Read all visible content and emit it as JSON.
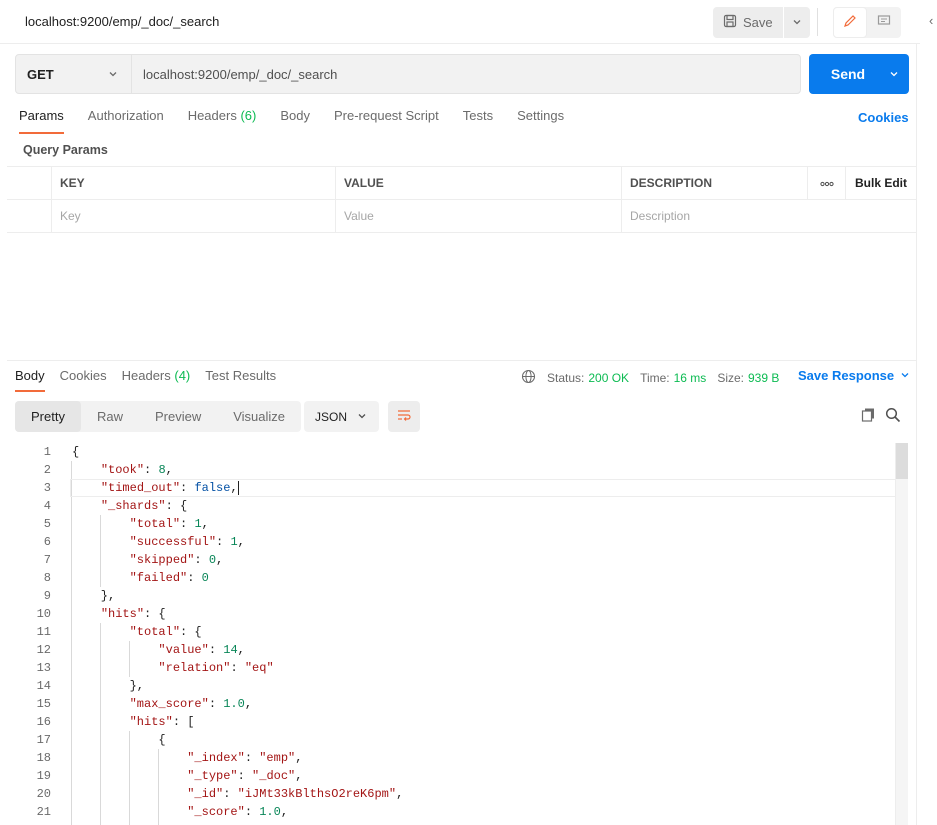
{
  "tab": {
    "title": "localhost:9200/emp/_doc/_search"
  },
  "toolbar": {
    "save_label": "Save"
  },
  "request": {
    "method": "GET",
    "url": "localhost:9200/emp/_doc/_search",
    "send_label": "Send",
    "tabs": [
      {
        "label": "Params",
        "count": ""
      },
      {
        "label": "Authorization",
        "count": ""
      },
      {
        "label": "Headers",
        "count": "(6)"
      },
      {
        "label": "Body",
        "count": ""
      },
      {
        "label": "Pre-request Script",
        "count": ""
      },
      {
        "label": "Tests",
        "count": ""
      },
      {
        "label": "Settings",
        "count": ""
      }
    ],
    "cookies_label": "Cookies"
  },
  "params": {
    "title": "Query Params",
    "headers": {
      "key": "KEY",
      "value": "VALUE",
      "description": "DESCRIPTION",
      "bulk_edit": "Bulk Edit"
    },
    "placeholders": {
      "key": "Key",
      "value": "Value",
      "description": "Description"
    }
  },
  "response": {
    "tabs": [
      {
        "label": "Body",
        "count": ""
      },
      {
        "label": "Cookies",
        "count": ""
      },
      {
        "label": "Headers",
        "count": "(4)"
      },
      {
        "label": "Test Results",
        "count": ""
      }
    ],
    "status_label": "Status:",
    "status_value": "200 OK",
    "time_label": "Time:",
    "time_value": "16 ms",
    "size_label": "Size:",
    "size_value": "939 B",
    "save_response_label": "Save Response",
    "views": [
      "Pretty",
      "Raw",
      "Preview",
      "Visualize"
    ],
    "format": "JSON"
  },
  "code_lines": [
    {
      "n": "1",
      "html": "{"
    },
    {
      "n": "2",
      "html": "    <span class=\"key\">\"took\"</span>: <span class=\"num\">8</span>,"
    },
    {
      "n": "3",
      "html": "    <span class=\"key\">\"timed_out\"</span>: <span class=\"kw\">false</span>,"
    },
    {
      "n": "4",
      "html": "    <span class=\"key\">\"_shards\"</span>: {"
    },
    {
      "n": "5",
      "html": "        <span class=\"key\">\"total\"</span>: <span class=\"num\">1</span>,"
    },
    {
      "n": "6",
      "html": "        <span class=\"key\">\"successful\"</span>: <span class=\"num\">1</span>,"
    },
    {
      "n": "7",
      "html": "        <span class=\"key\">\"skipped\"</span>: <span class=\"num\">0</span>,"
    },
    {
      "n": "8",
      "html": "        <span class=\"key\">\"failed\"</span>: <span class=\"num\">0</span>"
    },
    {
      "n": "9",
      "html": "    },"
    },
    {
      "n": "10",
      "html": "    <span class=\"key\">\"hits\"</span>: {"
    },
    {
      "n": "11",
      "html": "        <span class=\"key\">\"total\"</span>: {"
    },
    {
      "n": "12",
      "html": "            <span class=\"key\">\"value\"</span>: <span class=\"num\">14</span>,"
    },
    {
      "n": "13",
      "html": "            <span class=\"key\">\"relation\"</span>: <span class=\"str\">\"eq\"</span>"
    },
    {
      "n": "14",
      "html": "        },"
    },
    {
      "n": "15",
      "html": "        <span class=\"key\">\"max_score\"</span>: <span class=\"num\">1.0</span>,"
    },
    {
      "n": "16",
      "html": "        <span class=\"key\">\"hits\"</span>: ["
    },
    {
      "n": "17",
      "html": "            {"
    },
    {
      "n": "18",
      "html": "                <span class=\"key\">\"_index\"</span>: <span class=\"str\">\"emp\"</span>,"
    },
    {
      "n": "19",
      "html": "                <span class=\"key\">\"_type\"</span>: <span class=\"str\">\"_doc\"</span>,"
    },
    {
      "n": "20",
      "html": "                <span class=\"key\">\"_id\"</span>: <span class=\"str\">\"iJMt33kBlthsO2reK6pm\"</span>,"
    },
    {
      "n": "21",
      "html": "                <span class=\"key\">\"_score\"</span>: <span class=\"num\">1.0</span>,"
    }
  ],
  "colors": {
    "accent": "#097bed",
    "tab_underline": "#f26b3a",
    "success": "#0cbb52"
  },
  "icons": [
    "save-icon",
    "chevron-down-icon",
    "pencil-icon",
    "comment-icon",
    "collapse-icon",
    "globe-icon",
    "wrap-icon",
    "copy-icon",
    "search-icon"
  ]
}
